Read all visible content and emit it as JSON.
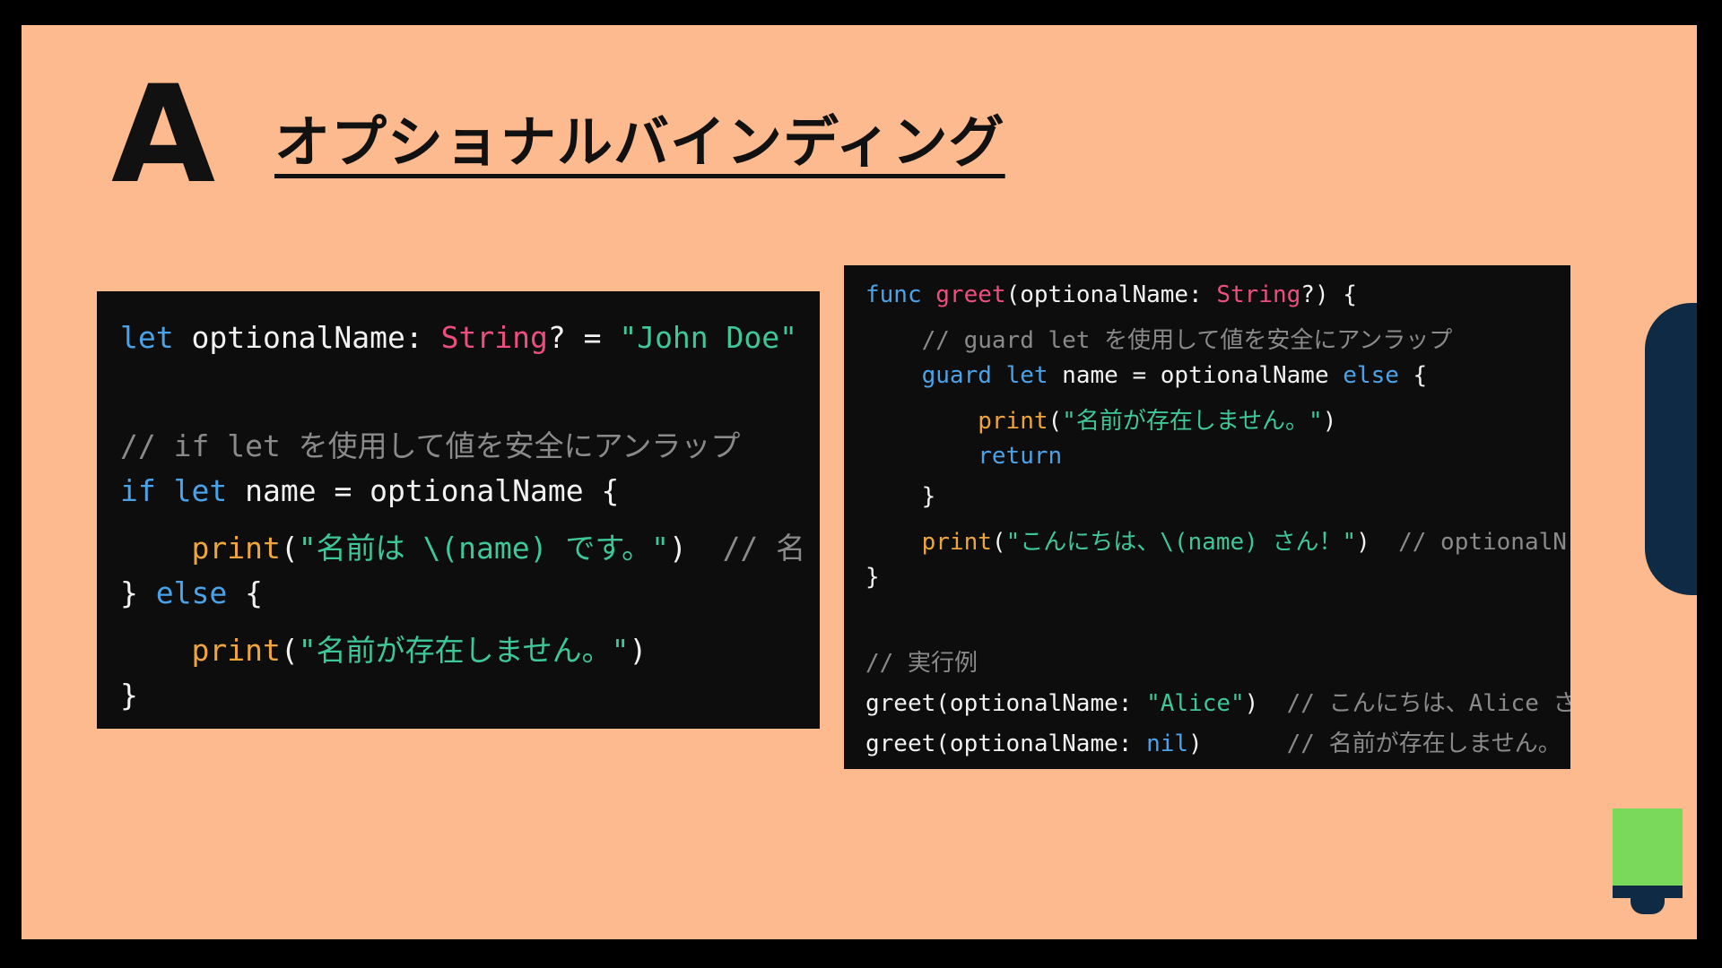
{
  "slide": {
    "letter": "A",
    "title": "オプショナルバインディング"
  },
  "code_left": {
    "lines": [
      [
        {
          "t": "let",
          "c": "kw"
        },
        {
          "t": " optionalName: ",
          "c": "pl"
        },
        {
          "t": "String",
          "c": "ty"
        },
        {
          "t": "? = ",
          "c": "pl"
        },
        {
          "t": "\"John Doe\"",
          "c": "st"
        }
      ],
      [],
      [
        {
          "t": "// if let を使用して値を安全にアンラップ",
          "c": "cm"
        }
      ],
      [
        {
          "t": "if",
          "c": "kw"
        },
        {
          "t": " ",
          "c": "pl"
        },
        {
          "t": "let",
          "c": "kw"
        },
        {
          "t": " name = optionalName {",
          "c": "pl"
        }
      ],
      [
        {
          "t": "    ",
          "c": "pl"
        },
        {
          "t": "print",
          "c": "fn"
        },
        {
          "t": "(",
          "c": "pl"
        },
        {
          "t": "\"名前は \\(name) です。\"",
          "c": "st"
        },
        {
          "t": ")  ",
          "c": "pl"
        },
        {
          "t": "// 名",
          "c": "cm"
        }
      ],
      [
        {
          "t": "} ",
          "c": "pl"
        },
        {
          "t": "else",
          "c": "kw"
        },
        {
          "t": " {",
          "c": "pl"
        }
      ],
      [
        {
          "t": "    ",
          "c": "pl"
        },
        {
          "t": "print",
          "c": "fn"
        },
        {
          "t": "(",
          "c": "pl"
        },
        {
          "t": "\"名前が存在しません。\"",
          "c": "st"
        },
        {
          "t": ")",
          "c": "pl"
        }
      ],
      [
        {
          "t": "}",
          "c": "pl"
        }
      ]
    ]
  },
  "code_right": {
    "lines": [
      [
        {
          "t": "func",
          "c": "kw"
        },
        {
          "t": " ",
          "c": "pl"
        },
        {
          "t": "greet",
          "c": "ty"
        },
        {
          "t": "(optionalName: ",
          "c": "pl"
        },
        {
          "t": "String",
          "c": "ty"
        },
        {
          "t": "?) {",
          "c": "pl"
        }
      ],
      [
        {
          "t": "    ",
          "c": "pl"
        },
        {
          "t": "// guard let を使用して値を安全にアンラップ",
          "c": "cm"
        }
      ],
      [
        {
          "t": "    ",
          "c": "pl"
        },
        {
          "t": "guard",
          "c": "kw"
        },
        {
          "t": " ",
          "c": "pl"
        },
        {
          "t": "let",
          "c": "kw"
        },
        {
          "t": " name = optionalName ",
          "c": "pl"
        },
        {
          "t": "else",
          "c": "kw"
        },
        {
          "t": " {",
          "c": "pl"
        }
      ],
      [
        {
          "t": "        ",
          "c": "pl"
        },
        {
          "t": "print",
          "c": "fn"
        },
        {
          "t": "(",
          "c": "pl"
        },
        {
          "t": "\"名前が存在しません。\"",
          "c": "st"
        },
        {
          "t": ")",
          "c": "pl"
        }
      ],
      [
        {
          "t": "        ",
          "c": "pl"
        },
        {
          "t": "return",
          "c": "kw"
        }
      ],
      [
        {
          "t": "    }",
          "c": "pl"
        }
      ],
      [
        {
          "t": "    ",
          "c": "pl"
        },
        {
          "t": "print",
          "c": "fn"
        },
        {
          "t": "(",
          "c": "pl"
        },
        {
          "t": "\"こんにちは、\\(name) さん！\"",
          "c": "st"
        },
        {
          "t": ")  ",
          "c": "pl"
        },
        {
          "t": "// optionalN",
          "c": "cm"
        }
      ],
      [
        {
          "t": "}",
          "c": "pl"
        }
      ],
      [],
      [
        {
          "t": "// 実行例",
          "c": "cm"
        }
      ],
      [
        {
          "t": "greet(optionalName: ",
          "c": "pl"
        },
        {
          "t": "\"Alice\"",
          "c": "st"
        },
        {
          "t": ")  ",
          "c": "pl"
        },
        {
          "t": "// こんにちは、Alice さ",
          "c": "cm"
        }
      ],
      [
        {
          "t": "greet(optionalName: ",
          "c": "pl"
        },
        {
          "t": "nil",
          "c": "kw"
        },
        {
          "t": ")      ",
          "c": "pl"
        },
        {
          "t": "// 名前が存在しません。",
          "c": "cm"
        }
      ]
    ]
  }
}
